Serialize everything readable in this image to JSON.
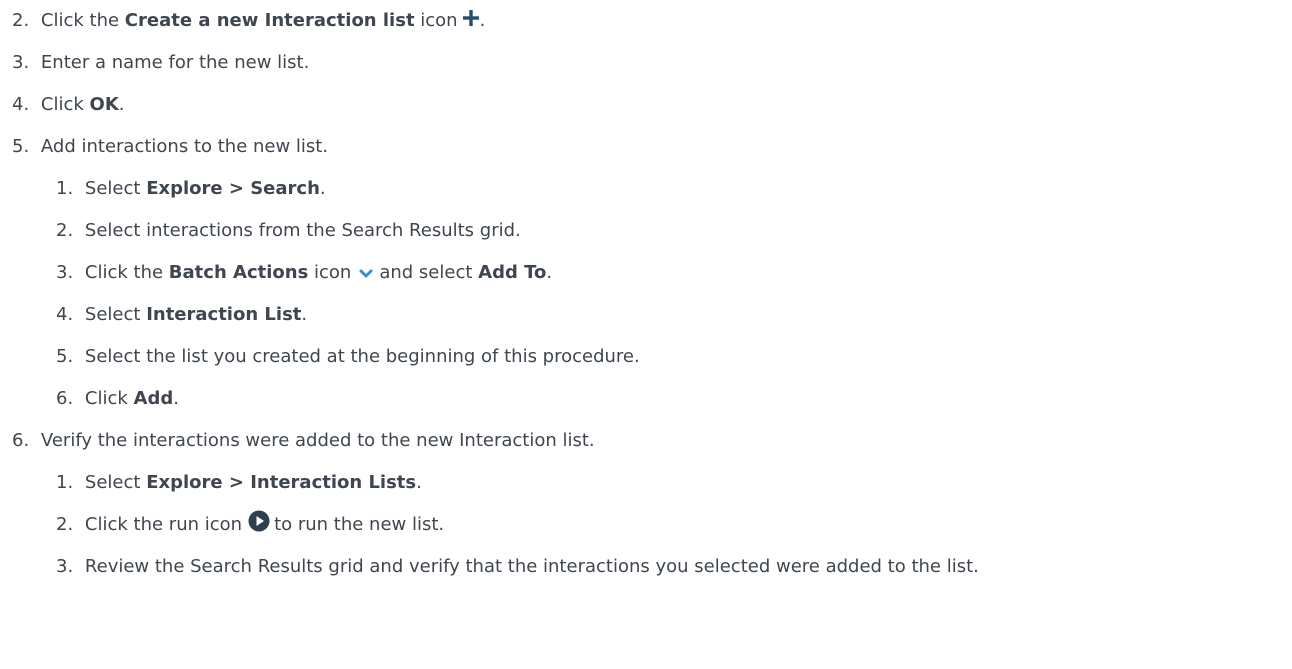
{
  "steps": [
    {
      "number": "2.",
      "pre": "Click the ",
      "bold": "Create a new Interaction list",
      "post": " icon",
      "icon": "plus-icon",
      "tail": "."
    },
    {
      "number": "3.",
      "text": "Enter a name for the new list."
    },
    {
      "number": "4.",
      "pre": "Click ",
      "bold": "OK",
      "post": "."
    },
    {
      "number": "5.",
      "text": "Add interactions to the new list."
    },
    {
      "number": "6.",
      "text": "Verify the interactions were added to the new Interaction list."
    }
  ],
  "substeps5": [
    {
      "number": "1.",
      "pre": "Select ",
      "bold": "Explore > Search",
      "post": "."
    },
    {
      "number": "2.",
      "text": "Select interactions from the Search Results grid."
    },
    {
      "number": "3.",
      "pre": "Click the ",
      "bold": "Batch Actions",
      "mid": " icon",
      "icon": "chevron-down-icon",
      "mid2": "and select ",
      "bold2": "Add To",
      "post": "."
    },
    {
      "number": "4.",
      "pre": "Select ",
      "bold": "Interaction List",
      "post": "."
    },
    {
      "number": "5.",
      "text": "Select the list you created at the beginning of this procedure."
    },
    {
      "number": "6.",
      "pre": "Click ",
      "bold": "Add",
      "post": "."
    }
  ],
  "substeps6": [
    {
      "number": "1.",
      "pre": "Select ",
      "bold": "Explore > Interaction Lists",
      "post": "."
    },
    {
      "number": "2.",
      "pre": "Click the run icon",
      "icon": "play-icon",
      "post": "to run the new list."
    },
    {
      "number": "3.",
      "text": "Review the Search Results grid and verify that the interactions you selected were added to the list."
    }
  ],
  "colors": {
    "text": "#3f464f",
    "icon_blue": "#2a4a6f",
    "chevron_blue": "#3a8fd6",
    "play_dark": "#2f3f50"
  }
}
